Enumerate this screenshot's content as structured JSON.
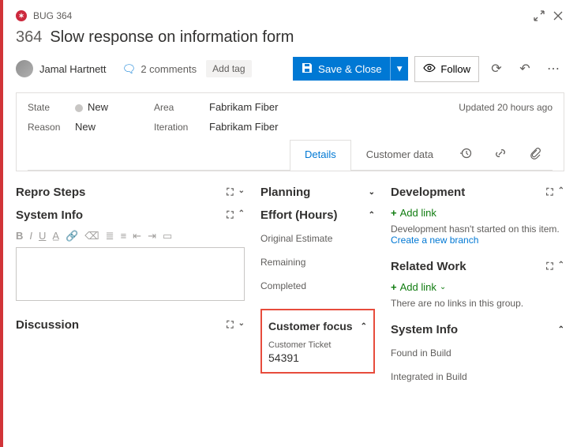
{
  "header": {
    "type_label": "BUG 364",
    "id": "364",
    "title": "Slow response on information form",
    "assignee": "Jamal Hartnett",
    "comments_count": "2 comments",
    "add_tag": "Add tag",
    "save_label": "Save & Close",
    "follow_label": "Follow"
  },
  "fields": {
    "state_label": "State",
    "state_value": "New",
    "reason_label": "Reason",
    "reason_value": "New",
    "area_label": "Area",
    "area_value": "Fabrikam Fiber",
    "iteration_label": "Iteration",
    "iteration_value": "Fabrikam Fiber",
    "updated": "Updated 20 hours ago"
  },
  "tabs": {
    "details": "Details",
    "customer_data": "Customer data"
  },
  "col1": {
    "repro_steps": "Repro Steps",
    "system_info": "System Info",
    "discussion": "Discussion"
  },
  "col2": {
    "planning": "Planning",
    "effort": "Effort (Hours)",
    "original_estimate": "Original Estimate",
    "remaining": "Remaining",
    "completed": "Completed",
    "customer_focus": "Customer focus",
    "customer_ticket_label": "Customer Ticket",
    "customer_ticket_value": "54391"
  },
  "col3": {
    "development": "Development",
    "dev_addlink": "Add link",
    "dev_helper": "Development hasn't started on this item.",
    "dev_helper2": "Create a new branch",
    "related_work": "Related Work",
    "rw_addlink": "Add link",
    "rw_empty": "There are no links in this group.",
    "system_info": "System Info",
    "found_in_build": "Found in Build",
    "integrated_in_build": "Integrated in Build"
  }
}
